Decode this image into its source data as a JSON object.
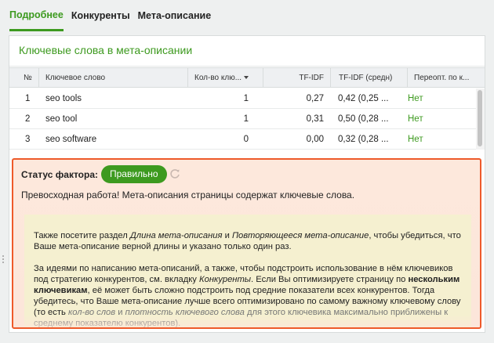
{
  "tabs": [
    {
      "label": "Подробнее",
      "active": true
    },
    {
      "label": "Конкуренты",
      "active": false
    },
    {
      "label": "Мета-описание",
      "active": false
    }
  ],
  "panel": {
    "title": "Ключевые слова в мета-описании"
  },
  "table": {
    "columns": [
      "№",
      "Ключевое слово",
      "Кол-во клю...",
      "TF-IDF",
      "TF-IDF (средн)",
      "Переопт. по к..."
    ],
    "sort_column": "Кол-во клю...",
    "rows": [
      [
        "1",
        "seo tools",
        "1",
        "0,27",
        "0,42 (0,25 ...",
        "Нет"
      ],
      [
        "2",
        "seo tool",
        "1",
        "0,31",
        "0,50 (0,28 ...",
        "Нет"
      ],
      [
        "3",
        "seo software",
        "0",
        "0,00",
        "0,32 (0,28 ...",
        "Нет"
      ]
    ]
  },
  "factor": {
    "status_label": "Статус фактора:",
    "status_value": "Правильно",
    "lead": "Превосходная работа! Мета-описания страницы содержат ключевые слова.",
    "note_p1": {
      "t1": "Также посетите раздел ",
      "i1": "Длина мета-описания",
      "t2": " и ",
      "i2": "Повторяющееся мета-описание",
      "t3": ", чтобы убедиться, что Ваше мета-описание верной длины и указано только один раз."
    },
    "note_p2": {
      "t1": "За идеями по написанию мета-описаний, а также, чтобы подстроить использование в нём ключевиков под стратегию конкурентов, см. вкладку ",
      "i1": "Конкуренты",
      "t2": ". Если Вы оптимизируете страницу по ",
      "b1": "нескольким ключевикам",
      "t3": ", её может быть сложно подстроить под средние показатели всех конкурентов. Тогда убедитесь, что Ваше мета-описание лучше всего оптимизировано по самому важному ключевому слову (то есть ",
      "i2": "кол-во слов",
      "t4": " и ",
      "i3": "плотность ключевого слова",
      "t5": " для этого ключевика максимально приближены к среднему показателю конкурентов)."
    }
  },
  "colors": {
    "accent_green": "#3d9a1f",
    "status_border": "#ee5a2a",
    "status_bg": "#fde8dc",
    "note_bg": "#f5f0d0"
  },
  "icons": [
    "refresh-icon",
    "sort-desc-icon",
    "drag-handle-icon"
  ]
}
